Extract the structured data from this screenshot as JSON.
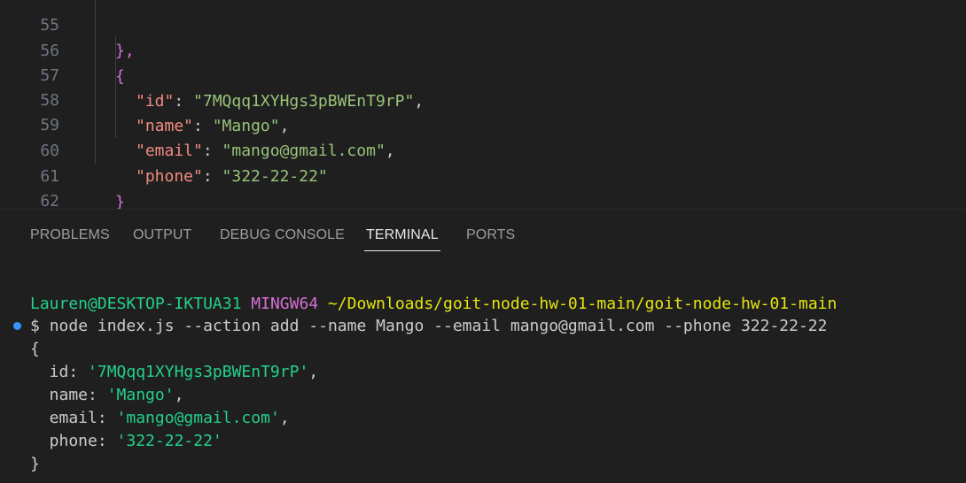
{
  "editor": {
    "lines": [
      {
        "num": "55",
        "open": "},"
      },
      {
        "num": "56",
        "open": "{"
      },
      {
        "num": "57",
        "key": "\"id\"",
        "sep": ": ",
        "value": "\"7MQqq1XYHgs3pBWEnT9rP\"",
        "end": ","
      },
      {
        "num": "58",
        "key": "\"name\"",
        "sep": ": ",
        "value": "\"Mango\"",
        "end": ","
      },
      {
        "num": "59",
        "key": "\"email\"",
        "sep": ": ",
        "value": "\"mango@gmail.com\"",
        "end": ","
      },
      {
        "num": "60",
        "key": "\"phone\"",
        "sep": ": ",
        "value": "\"322-22-22\"",
        "end": ""
      },
      {
        "num": "61",
        "open": "}"
      },
      {
        "num": "62",
        "open": "]"
      }
    ]
  },
  "panel": {
    "tabs": [
      {
        "label": "PROBLEMS"
      },
      {
        "label": "OUTPUT"
      },
      {
        "label": "DEBUG CONSOLE"
      },
      {
        "label": "TERMINAL",
        "active": true
      },
      {
        "label": "PORTS"
      }
    ]
  },
  "terminal": {
    "user": "Lauren@DESKTOP-IKTUA31",
    "system": "MINGW64",
    "path": "~/Downloads/goit-node-hw-01-main/goit-node-hw-01-main",
    "prompt": "$",
    "command": "node index.js --action add --name Mango --email mango@gmail.com --phone 322-22-22",
    "output": {
      "open": "{",
      "id_key": "  id: ",
      "id_val": "'7MQqq1XYHgs3pBWEnT9rP'",
      "name_key": "  name: ",
      "name_val": "'Mango'",
      "email_key": "  email: ",
      "email_val": "'mango@gmail.com'",
      "phone_key": "  phone: ",
      "phone_val": "'322-22-22'",
      "comma": ",",
      "close": "}"
    }
  }
}
